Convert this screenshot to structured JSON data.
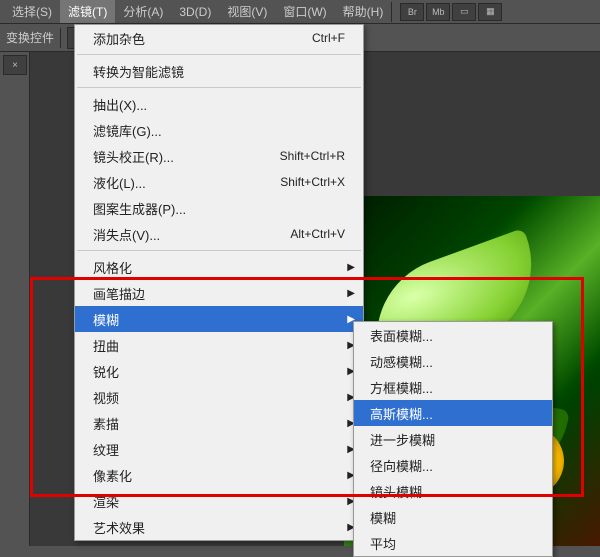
{
  "menubar": {
    "items": [
      "选择(S)",
      "滤镜(T)",
      "分析(A)",
      "3D(D)",
      "视图(V)",
      "窗口(W)",
      "帮助(H)"
    ],
    "active_index": 1,
    "icons": [
      "Br",
      "Mb",
      "■",
      "■"
    ]
  },
  "toolbar": {
    "label": "变换控件"
  },
  "side": {
    "tab_label": "×"
  },
  "menu": {
    "groups": [
      [
        {
          "label": "添加杂色",
          "shortcut": "Ctrl+F"
        }
      ],
      [
        {
          "label": "转换为智能滤镜"
        }
      ],
      [
        {
          "label": "抽出(X)..."
        },
        {
          "label": "滤镜库(G)..."
        },
        {
          "label": "镜头校正(R)...",
          "shortcut": "Shift+Ctrl+R"
        },
        {
          "label": "液化(L)...",
          "shortcut": "Shift+Ctrl+X"
        },
        {
          "label": "图案生成器(P)..."
        },
        {
          "label": "消失点(V)...",
          "shortcut": "Alt+Ctrl+V"
        }
      ],
      [
        {
          "label": "风格化",
          "sub": true
        },
        {
          "label": "画笔描边",
          "sub": true
        },
        {
          "label": "模糊",
          "sub": true,
          "highlight": true
        },
        {
          "label": "扭曲",
          "sub": true
        },
        {
          "label": "锐化",
          "sub": true
        },
        {
          "label": "视频",
          "sub": true
        },
        {
          "label": "素描",
          "sub": true
        },
        {
          "label": "纹理",
          "sub": true
        },
        {
          "label": "像素化",
          "sub": true
        },
        {
          "label": "渲染",
          "sub": true
        },
        {
          "label": "艺术效果",
          "sub": true
        }
      ]
    ]
  },
  "submenu": {
    "items": [
      {
        "label": "表面模糊..."
      },
      {
        "label": "动感模糊..."
      },
      {
        "label": "方框模糊..."
      },
      {
        "label": "高斯模糊...",
        "highlight": true
      },
      {
        "label": "进一步模糊"
      },
      {
        "label": "径向模糊..."
      },
      {
        "label": "镜头模糊..."
      },
      {
        "label": "模糊"
      },
      {
        "label": "平均"
      }
    ]
  }
}
